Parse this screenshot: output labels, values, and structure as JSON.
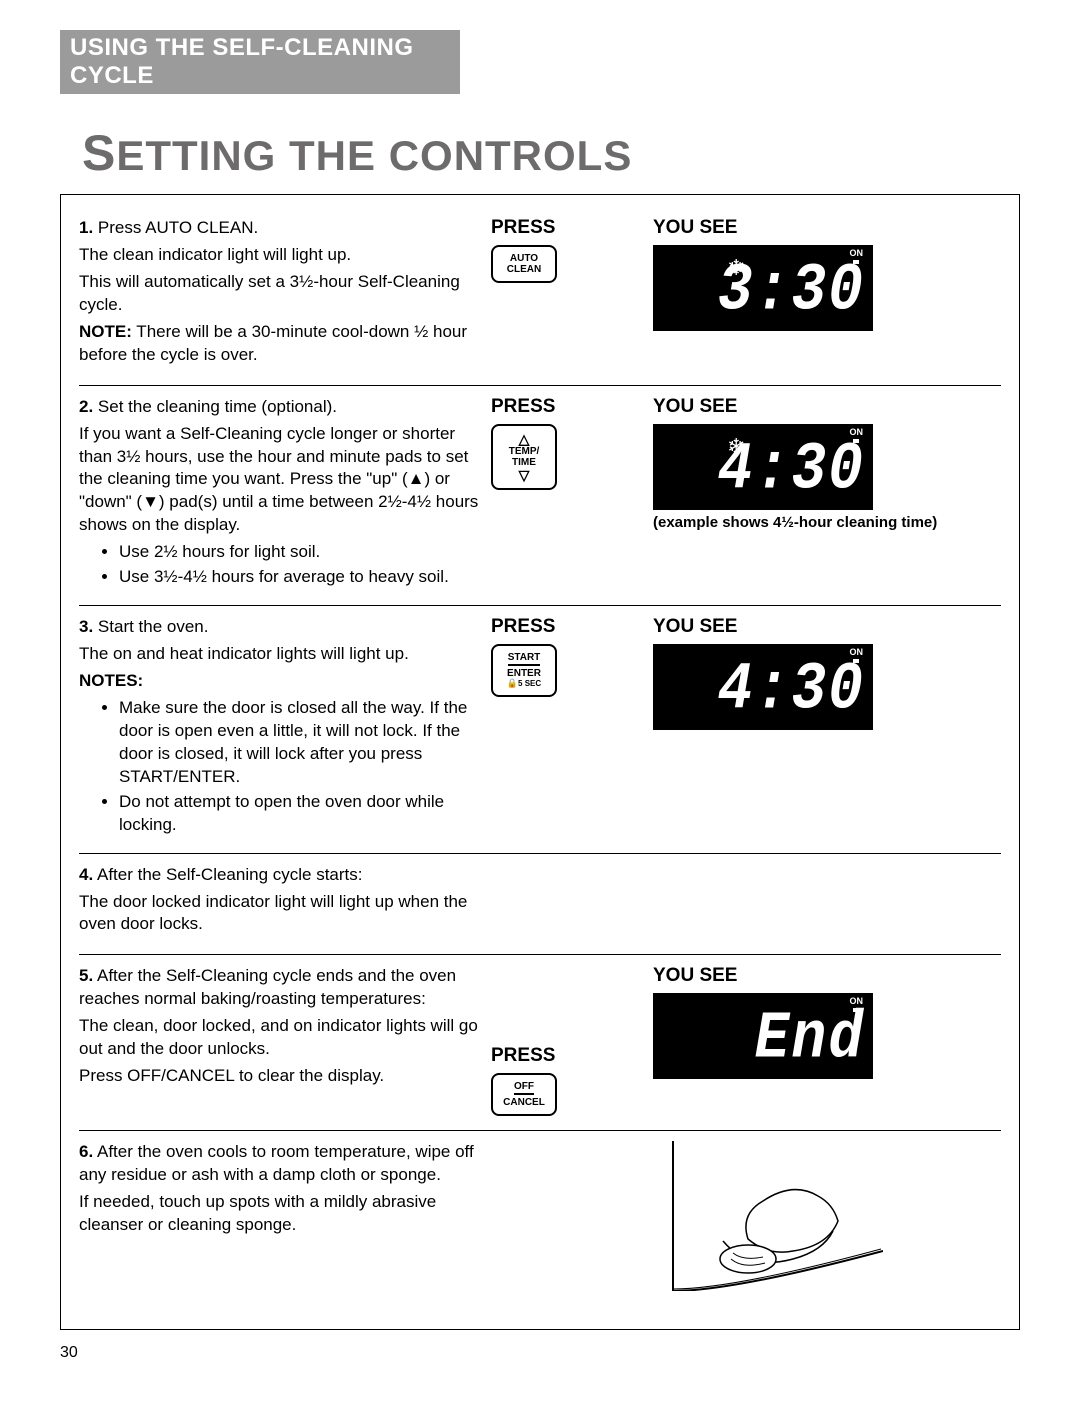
{
  "section_header": "USING THE SELF-CLEANING CYCLE",
  "title": "SETTING THE CONTROLS",
  "labels": {
    "press": "PRESS",
    "you_see": "YOU SEE",
    "on": "ON"
  },
  "buttons": {
    "auto_clean_l1": "AUTO",
    "auto_clean_l2": "CLEAN",
    "temp_time_l1": "TEMP/",
    "temp_time_l2": "TIME",
    "start_l1": "START",
    "start_l2": "ENTER",
    "start_l3": "5 SEC",
    "off_l1": "OFF",
    "off_l2": "CANCEL"
  },
  "displays": {
    "d1": "3:30",
    "d2": "4:30",
    "d2_caption": "(example shows 4½-hour cleaning time)",
    "d3": "4:30",
    "d5": "End"
  },
  "steps": {
    "s1": {
      "num": "1.",
      "lead": "Press AUTO CLEAN.",
      "p1": "The clean indicator light will light up.",
      "p2": "This will automatically set a 3½-hour Self-Cleaning cycle.",
      "note_label": "NOTE:",
      "note": " There will be a 30-minute cool-down ½ hour before the cycle is over."
    },
    "s2": {
      "num": "2.",
      "lead": "Set the cleaning time (optional).",
      "p1": "If you want a Self-Cleaning cycle longer or shorter than 3½ hours, use the hour and minute pads to set the cleaning time you want. Press the \"up\" (▲) or \"down\" (▼) pad(s) until a time between 2½-4½ hours shows on the display.",
      "b1": "Use 2½ hours for light soil.",
      "b2": "Use 3½-4½ hours for average to heavy soil."
    },
    "s3": {
      "num": "3.",
      "lead": "Start the oven.",
      "p1": "The on and heat indicator lights will light up.",
      "notes_label": "NOTES:",
      "b1": "Make sure the door is closed all the way. If the door is open even a little, it will not lock. If the door is closed, it will lock after you press START/ENTER.",
      "b2": "Do not attempt to open the oven door while locking."
    },
    "s4": {
      "num": "4.",
      "lead": "After the Self-Cleaning cycle starts:",
      "p1": "The door locked indicator light will light up when the oven door locks."
    },
    "s5": {
      "num": "5.",
      "lead": "After the Self-Cleaning cycle ends and the oven reaches normal baking/roasting temperatures:",
      "p1": "The clean, door locked, and on indicator lights will go out and the door unlocks.",
      "p2": "Press OFF/CANCEL to clear the display."
    },
    "s6": {
      "num": "6.",
      "lead": "After the oven cools to room temperature, wipe off any residue or ash with a damp cloth or sponge.",
      "p1": "If needed, touch up spots with a mildly abrasive cleanser or cleaning sponge."
    }
  },
  "page_number": "30"
}
